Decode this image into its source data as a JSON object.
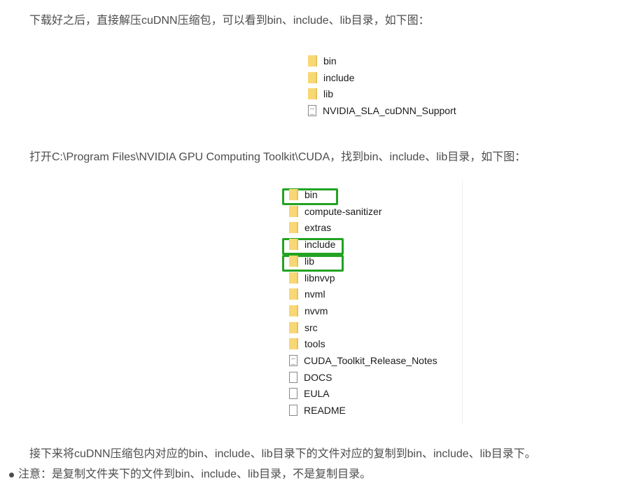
{
  "paragraphs": {
    "p1": "下载好之后，直接解压cuDNN压缩包，可以看到bin、include、lib目录，如下图：",
    "p2": "打开C:\\Program Files\\NVIDIA GPU Computing Toolkit\\CUDA，找到bin、include、lib目录，如下图：",
    "p3": "接下来将cuDNN压缩包内对应的bin、include、lib目录下的文件对应的复制到bin、include、lib目录下。",
    "note": "注意：是复制文件夹下的文件到bin、include、lib目录，不是复制目录。"
  },
  "image1": [
    {
      "name": "bin",
      "type": "folder"
    },
    {
      "name": "include",
      "type": "folder"
    },
    {
      "name": "lib",
      "type": "folder"
    },
    {
      "name": "NVIDIA_SLA_cuDNN_Support",
      "type": "text-file"
    }
  ],
  "image2": [
    {
      "name": "bin",
      "type": "folder",
      "highlighted": true
    },
    {
      "name": "compute-sanitizer",
      "type": "folder"
    },
    {
      "name": "extras",
      "type": "folder"
    },
    {
      "name": "include",
      "type": "folder",
      "highlighted": true
    },
    {
      "name": "lib",
      "type": "folder",
      "highlighted": true
    },
    {
      "name": "libnvvp",
      "type": "folder"
    },
    {
      "name": "nvml",
      "type": "folder"
    },
    {
      "name": "nvvm",
      "type": "folder"
    },
    {
      "name": "src",
      "type": "folder"
    },
    {
      "name": "tools",
      "type": "folder"
    },
    {
      "name": "CUDA_Toolkit_Release_Notes",
      "type": "text-file"
    },
    {
      "name": "DOCS",
      "type": "file"
    },
    {
      "name": "EULA",
      "type": "file"
    },
    {
      "name": "README",
      "type": "file"
    }
  ],
  "colors": {
    "text": "#4d4d4d",
    "highlight": "#22a322",
    "folder": "#f8d775"
  }
}
